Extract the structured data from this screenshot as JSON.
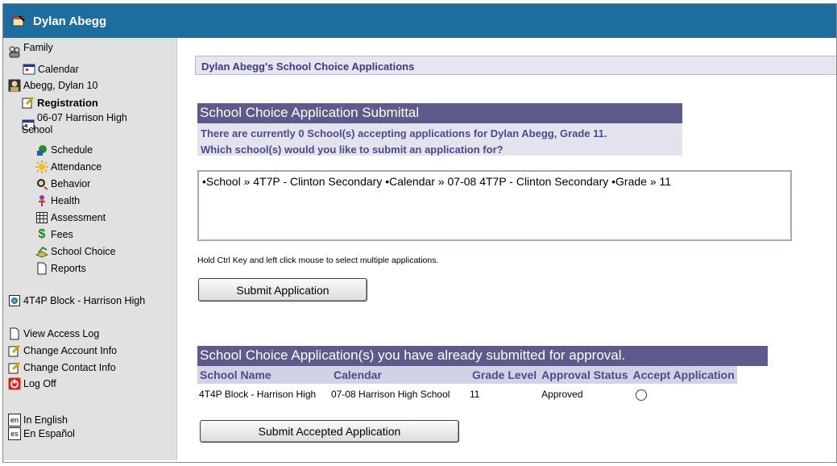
{
  "window": {
    "title": "Dylan Abegg"
  },
  "sidebar": {
    "family": "Family",
    "family_calendar": "Calendar",
    "student": "Abegg, Dylan 10",
    "registration": "Registration",
    "calendar_line1": "06-07 Harrison High",
    "calendar_line2": "School",
    "items": [
      "Schedule",
      "Attendance",
      "Behavior",
      "Health",
      "Assessment",
      "Fees",
      "School Choice",
      "Reports"
    ],
    "block": "4T4P Block - Harrison High",
    "view_access_log": "View Access Log",
    "change_account": "Change Account Info",
    "change_contact": "Change Contact Info",
    "log_off": "Log Off",
    "english": "In English",
    "espanol": "En Español",
    "lang_en_code": "en",
    "lang_es_code": "es"
  },
  "main": {
    "page_heading": "Dylan Abegg's School Choice Applications",
    "section1": {
      "title": "School Choice Application Submittal",
      "line1": "There are currently 0 School(s) accepting applications for Dylan Abegg, Grade 11.",
      "line2": "Which school(s) would you like to submit an application for?",
      "option": "•School » 4T7P - Clinton Secondary •Calendar » 07-08 4T7P - Clinton Secondary •Grade » 11",
      "hint": "Hold Ctrl Key and left click mouse to select multiple applications.",
      "submit_label": "Submit Application"
    },
    "section2": {
      "title": "School Choice Application(s) you have already submitted for approval.",
      "columns": [
        "School Name",
        "Calendar",
        "Grade Level",
        "Approval Status",
        "Accept Application"
      ],
      "rows": [
        {
          "school": "4T4P Block - Harrison High",
          "calendar": "07-08 Harrison High School",
          "grade": "11",
          "status": "Approved"
        }
      ],
      "submit_label": "Submit Accepted Application"
    }
  },
  "colors": {
    "titlebar": "#1d6e9e",
    "section_header": "#5c5b8c",
    "table_header": "#d2d2e6",
    "sidebar_bg": "#e1e1e1"
  }
}
